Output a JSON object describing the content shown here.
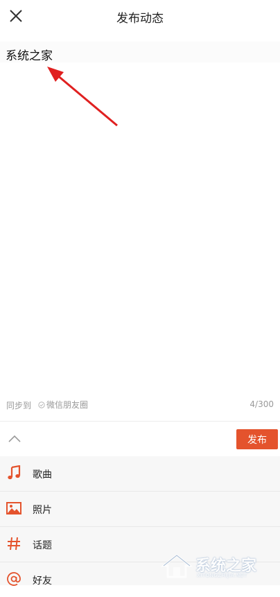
{
  "header": {
    "title": "发布动态"
  },
  "editor": {
    "text": "系统之家"
  },
  "sync": {
    "label": "同步到",
    "wechat_label": "微信朋友圈",
    "counter": "4/300"
  },
  "toolbar": {
    "publish_label": "发布"
  },
  "menu": {
    "items": [
      {
        "label": "歌曲",
        "icon": "music-note-icon"
      },
      {
        "label": "照片",
        "icon": "image-icon"
      },
      {
        "label": "话题",
        "icon": "hashtag-icon"
      },
      {
        "label": "好友",
        "icon": "at-icon"
      }
    ]
  },
  "watermark": {
    "text": "系统之家",
    "url": "XITONGZHIJIA.NET"
  },
  "colors": {
    "accent": "#e4532d",
    "arrow": "#e02020"
  }
}
